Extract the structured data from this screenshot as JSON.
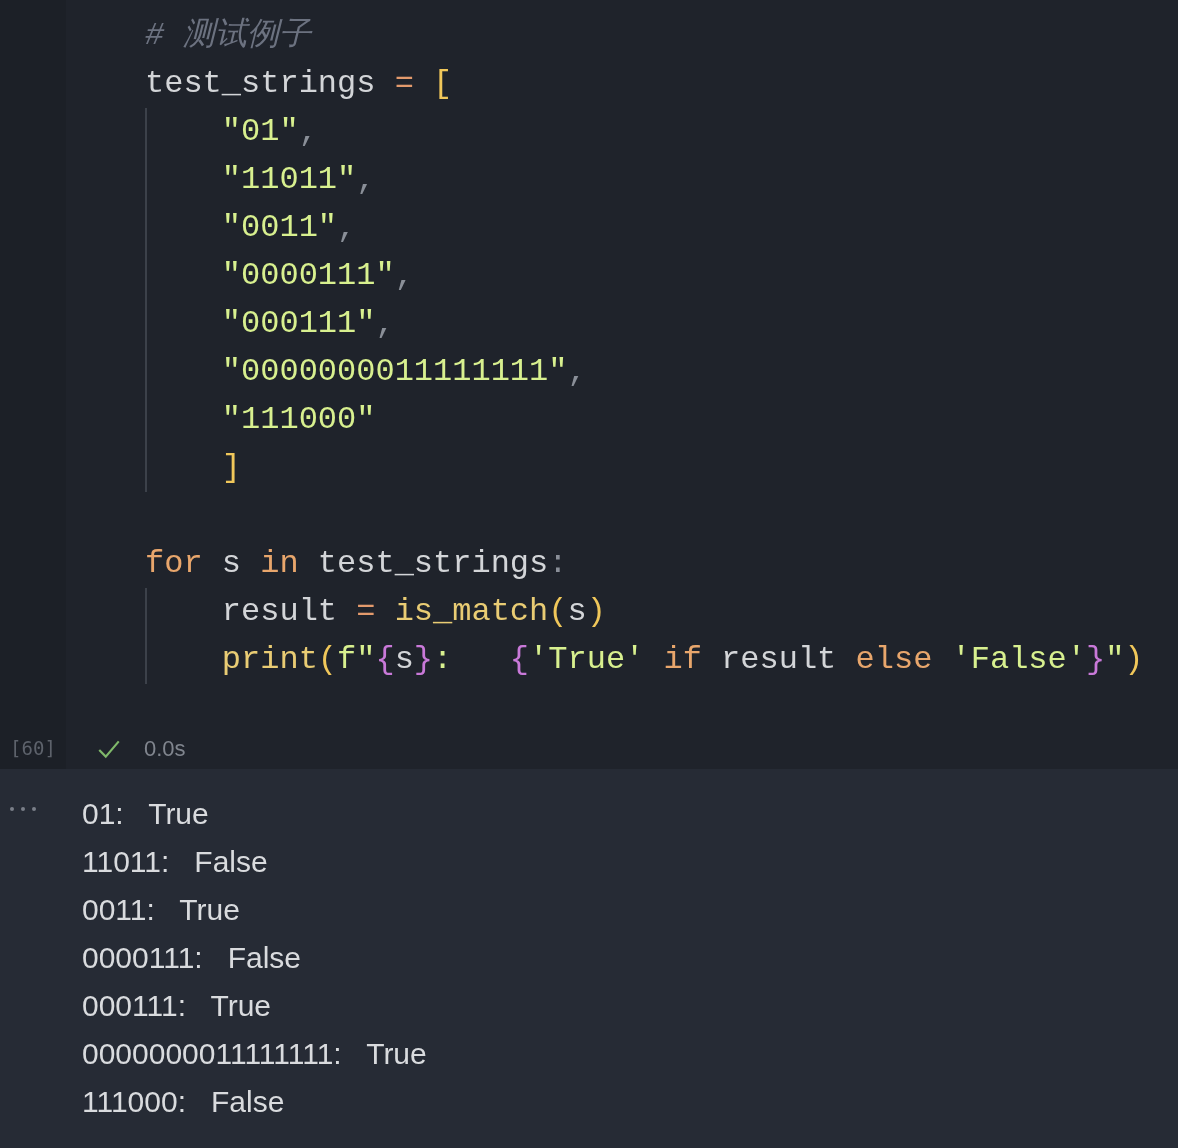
{
  "code_cell": {
    "blocks": [
      {
        "kind": "plain",
        "lines": [
          [
            {
              "kind": "comment",
              "text": "# 测试例子"
            }
          ],
          [
            {
              "kind": "name",
              "text": "test_strings "
            },
            {
              "kind": "operator",
              "text": "="
            },
            {
              "kind": "bracket",
              "text": " ["
            }
          ]
        ]
      },
      {
        "kind": "indented",
        "lines": [
          [
            {
              "kind": "string",
              "text": "\"01\""
            },
            {
              "kind": "punct",
              "text": ","
            }
          ],
          [
            {
              "kind": "string",
              "text": "\"11011\""
            },
            {
              "kind": "punct",
              "text": ","
            }
          ],
          [
            {
              "kind": "string",
              "text": "\"0011\""
            },
            {
              "kind": "punct",
              "text": ","
            }
          ],
          [
            {
              "kind": "string",
              "text": "\"0000111\""
            },
            {
              "kind": "punct",
              "text": ","
            }
          ],
          [
            {
              "kind": "string",
              "text": "\"000111\""
            },
            {
              "kind": "punct",
              "text": ","
            }
          ],
          [
            {
              "kind": "string",
              "text": "\"0000000011111111\""
            },
            {
              "kind": "punct",
              "text": ","
            }
          ],
          [
            {
              "kind": "string",
              "text": "\"111000\""
            }
          ],
          [
            {
              "kind": "bracket",
              "text": "]"
            }
          ]
        ]
      },
      {
        "kind": "blank"
      },
      {
        "kind": "plain",
        "lines": [
          [
            {
              "kind": "keyword",
              "text": "for"
            },
            {
              "kind": "name",
              "text": " s "
            },
            {
              "kind": "keyword",
              "text": "in"
            },
            {
              "kind": "name",
              "text": " test_strings"
            },
            {
              "kind": "punct",
              "text": ":"
            }
          ]
        ]
      },
      {
        "kind": "indented",
        "lines": [
          [
            {
              "kind": "name",
              "text": "result "
            },
            {
              "kind": "operator",
              "text": "="
            },
            {
              "kind": "func",
              "text": " is_match"
            },
            {
              "kind": "bracket",
              "text": "("
            },
            {
              "kind": "name",
              "text": "s"
            },
            {
              "kind": "bracket",
              "text": ")"
            }
          ],
          [
            {
              "kind": "func",
              "text": "print"
            },
            {
              "kind": "bracket",
              "text": "("
            },
            {
              "kind": "string",
              "text": "f\""
            },
            {
              "kind": "brace",
              "text": "{"
            },
            {
              "kind": "name",
              "text": "s"
            },
            {
              "kind": "brace",
              "text": "}"
            },
            {
              "kind": "string",
              "text": ":   "
            },
            {
              "kind": "brace",
              "text": "{"
            },
            {
              "kind": "string",
              "text": "'True' "
            },
            {
              "kind": "keyword",
              "text": "if"
            },
            {
              "kind": "name",
              "text": " result "
            },
            {
              "kind": "keyword",
              "text": "else"
            },
            {
              "kind": "string",
              "text": " 'False'"
            },
            {
              "kind": "brace",
              "text": "}"
            },
            {
              "kind": "string",
              "text": "\""
            },
            {
              "kind": "bracket",
              "text": ")"
            }
          ]
        ]
      }
    ],
    "execution_count": "[60]",
    "status": {
      "succeeded": true,
      "duration": "0.0s"
    }
  },
  "output": {
    "lines": [
      "01:   True",
      "11011:   False",
      "0011:   True",
      "0000111:   False",
      "000111:   True",
      "0000000011111111:   True",
      "111000:   False"
    ]
  }
}
